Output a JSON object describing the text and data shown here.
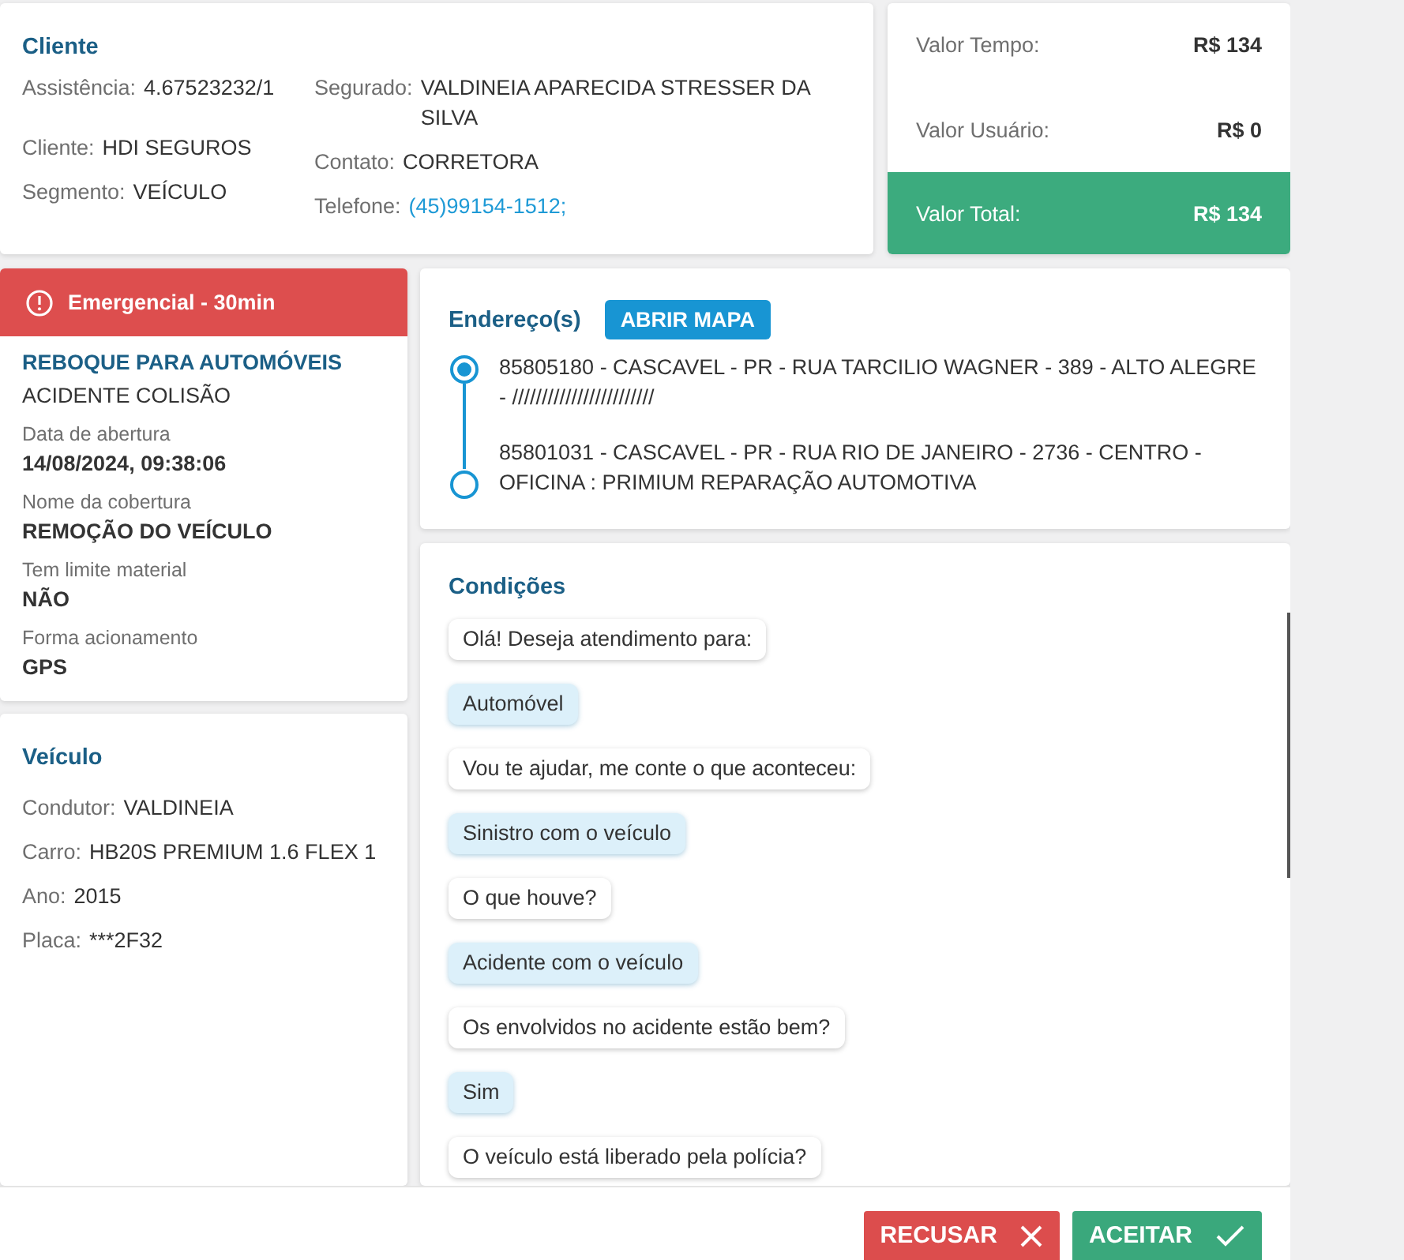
{
  "cliente": {
    "title": "Cliente",
    "left": [
      {
        "label": "Assistência:",
        "value": "4.67523232/1"
      },
      {
        "label": "Cliente:",
        "value": "HDI SEGUROS"
      },
      {
        "label": "Segmento:",
        "value": "VEÍCULO"
      }
    ],
    "right": [
      {
        "label": "Segurado:",
        "value": "VALDINEIA APARECIDA STRESSER DA SILVA",
        "kind": "text"
      },
      {
        "label": "Contato:",
        "value": "CORRETORA",
        "kind": "text"
      },
      {
        "label": "Telefone:",
        "value": "(45)99154-1512;",
        "kind": "link"
      }
    ]
  },
  "valores": [
    {
      "label": "Valor Tempo:",
      "value": "R$ 134",
      "kind": "plain"
    },
    {
      "label": "Valor Usuário:",
      "value": "R$ 0",
      "kind": "plain"
    },
    {
      "label": "Valor Total:",
      "value": "R$ 134",
      "kind": "total"
    }
  ],
  "servico": {
    "badge": "Emergencial - 30min",
    "title": "REBOQUE PARA AUTOMÓVEIS",
    "subtitle": "ACIDENTE COLISÃO",
    "fields": [
      {
        "label": "Data de abertura",
        "value": "14/08/2024, 09:38:06"
      },
      {
        "label": "Nome da cobertura",
        "value": "REMOÇÃO DO VEÍCULO"
      },
      {
        "label": "Tem limite material",
        "value": "NÃO"
      },
      {
        "label": "Forma acionamento",
        "value": "GPS"
      }
    ]
  },
  "veiculo": {
    "title": "Veículo",
    "rows": [
      {
        "label": "Condutor:",
        "value": "VALDINEIA"
      },
      {
        "label": "Carro:",
        "value": "HB20S PREMIUM 1.6 FLEX 1"
      },
      {
        "label": "Ano:",
        "value": "2015"
      },
      {
        "label": "Placa:",
        "value": "***2F32"
      }
    ]
  },
  "enderecos": {
    "title": "Endereço(s)",
    "button": "ABRIR MAPA",
    "items": [
      {
        "text": "85805180 - CASCAVEL - PR - RUA TARCILIO WAGNER - 389 - ALTO ALEGRE - ////////////////////////",
        "kind": "origin"
      },
      {
        "text": "85801031 - CASCAVEL - PR - RUA RIO DE JANEIRO - 2736 - CENTRO - OFICINA : PRIMIUM REPARAÇÃO AUTOMOTIVA",
        "kind": "destination"
      }
    ]
  },
  "condicoes": {
    "title": "Condições",
    "messages": [
      {
        "text": "Olá! Deseja atendimento para:",
        "kind": "question"
      },
      {
        "text": "Automóvel",
        "kind": "answer"
      },
      {
        "text": "Vou te ajudar, me conte o que aconteceu:",
        "kind": "question"
      },
      {
        "text": "Sinistro com o veículo",
        "kind": "answer"
      },
      {
        "text": "O que houve?",
        "kind": "question"
      },
      {
        "text": "Acidente com o veículo",
        "kind": "answer"
      },
      {
        "text": "Os envolvidos no acidente estão bem?",
        "kind": "question"
      },
      {
        "text": "Sim",
        "kind": "answer"
      },
      {
        "text": "O veículo está liberado pela polícia?",
        "kind": "question"
      }
    ]
  },
  "actions": [
    {
      "label": "RECUSAR",
      "kind": "reject"
    },
    {
      "label": "ACEITAR",
      "kind": "accept"
    }
  ]
}
